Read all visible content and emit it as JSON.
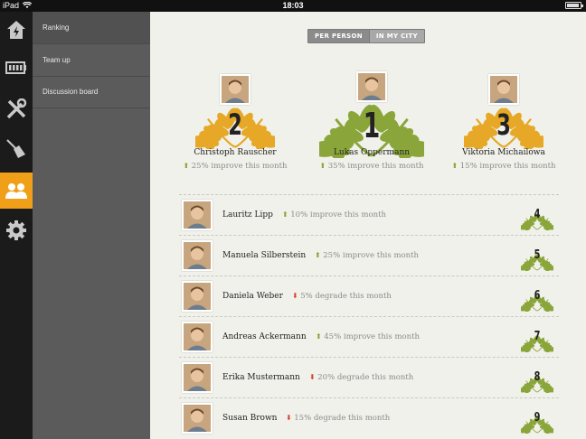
{
  "status": {
    "carrier": "iPad",
    "time": "18:03"
  },
  "rail": [
    {
      "icon": "home-bolt-icon",
      "active": false
    },
    {
      "icon": "battery-icon",
      "active": false
    },
    {
      "icon": "tools-icon",
      "active": false
    },
    {
      "icon": "broom-icon",
      "active": false
    },
    {
      "icon": "people-icon",
      "active": true
    },
    {
      "icon": "gear-icon",
      "active": false
    }
  ],
  "submenu": {
    "items": [
      "Ranking",
      "Team up",
      "Discussion board"
    ]
  },
  "segment": {
    "per_person": "PER PERSON",
    "in_city": "IN MY CITY"
  },
  "podium": [
    {
      "rank": "2",
      "name": "Christoph Rauscher",
      "trend": "25% improve this month",
      "direction": "up",
      "color": "#e6a826"
    },
    {
      "rank": "1",
      "name": "Lukas Oppermann",
      "trend": "35% improve this month",
      "direction": "up",
      "color": "#8aa63a"
    },
    {
      "rank": "3",
      "name": "Viktoria Michailowa",
      "trend": "15% improve this month",
      "direction": "up",
      "color": "#e6a826"
    }
  ],
  "ranking": [
    {
      "rank": "4",
      "name": "Lauritz Lipp",
      "trend": "10% improve this month",
      "direction": "up"
    },
    {
      "rank": "5",
      "name": "Manuela Silberstein",
      "trend": "25% improve this month",
      "direction": "up"
    },
    {
      "rank": "6",
      "name": "Daniela Weber",
      "trend": "5% degrade this month",
      "direction": "down"
    },
    {
      "rank": "7",
      "name": "Andreas Ackermann",
      "trend": "45% improve this month",
      "direction": "up"
    },
    {
      "rank": "8",
      "name": "Erika Mustermann",
      "trend": "20% degrade this month",
      "direction": "down"
    },
    {
      "rank": "9",
      "name": "Susan Brown",
      "trend": "15% degrade this month",
      "direction": "down"
    }
  ]
}
